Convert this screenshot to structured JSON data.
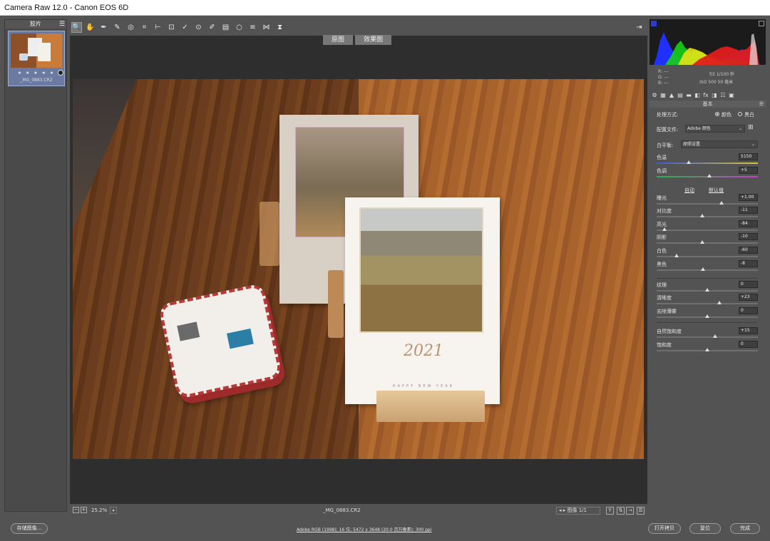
{
  "window": {
    "title": "Camera Raw 12.0 -  Canon EOS 6D"
  },
  "filmstrip": {
    "header": "胶片",
    "menu_icon": "menu-icon",
    "stars": "★ ★ ★ ★ ★",
    "thumb_name": "_MG_0883.CR2"
  },
  "toolbar": {
    "tools": [
      "zoom-icon",
      "hand-icon",
      "white-balance-icon",
      "color-sampler-icon",
      "target-adjust-icon",
      "crop-icon",
      "straighten-icon",
      "transform-icon",
      "spot-removal-icon",
      "red-eye-icon",
      "adjustment-brush-icon",
      "graduated-filter-icon",
      "radial-filter-icon",
      "presets-icon",
      "rotate-ccw-icon",
      "rotate-cw-icon"
    ]
  },
  "view_toggle": {
    "before": "原图",
    "after": "效果图"
  },
  "status": {
    "zoom": "25.2%",
    "filename": "_MG_0883.CR2",
    "image_nav": "图像 1/1"
  },
  "histogram": {
    "r_label": "R:",
    "g_label": "G:",
    "b_label": "B:",
    "dash": "---",
    "exif_line1": "f/2   1/100 秒",
    "exif_line2": "ISO 500   50 毫米",
    "colors": {
      "red": "#e01c1c",
      "green": "#15d115",
      "blue": "#2030ff",
      "yellow": "#e3e31a"
    }
  },
  "panel": {
    "title": "基本",
    "treatment_label": "处理方式:",
    "treatment_color": "颜色",
    "treatment_bw": "黑白",
    "profile_label": "配置文件:",
    "profile_value": "Adobe 颜色",
    "wb_label": "白平衡:",
    "wb_value": "原照设置",
    "auto": "自动",
    "default": "默认值",
    "sliders": [
      {
        "label": "色温",
        "value": "5150",
        "pos": 0.32
      },
      {
        "label": "色调",
        "value": "+5",
        "pos": 0.52
      },
      {
        "label": "曝光",
        "value": "+1.00",
        "pos": 0.64
      },
      {
        "label": "对比度",
        "value": "-11",
        "pos": 0.45
      },
      {
        "label": "高光",
        "value": "-84",
        "pos": 0.08
      },
      {
        "label": "阴影",
        "value": "-10",
        "pos": 0.45
      },
      {
        "label": "白色",
        "value": "-60",
        "pos": 0.2
      },
      {
        "label": "黑色",
        "value": "-8",
        "pos": 0.46
      },
      {
        "label": "纹理",
        "value": "0",
        "pos": 0.5
      },
      {
        "label": "清晰度",
        "value": "+23",
        "pos": 0.62
      },
      {
        "label": "去除薄雾",
        "value": "0",
        "pos": 0.5
      },
      {
        "label": "自然饱和度",
        "value": "+15",
        "pos": 0.58
      },
      {
        "label": "饱和度",
        "value": "0",
        "pos": 0.5
      }
    ]
  },
  "bottom": {
    "save": "存储图像...",
    "workflow": "Adobe RGB (1998); 16 位; 5472 x 3648 (20.0 百万像素); 300 ppi",
    "open": "打开拷贝",
    "reset": "复位",
    "done": "完成"
  },
  "calendar": {
    "year": "2021",
    "sub": "HAPPY NEW YEAR"
  }
}
